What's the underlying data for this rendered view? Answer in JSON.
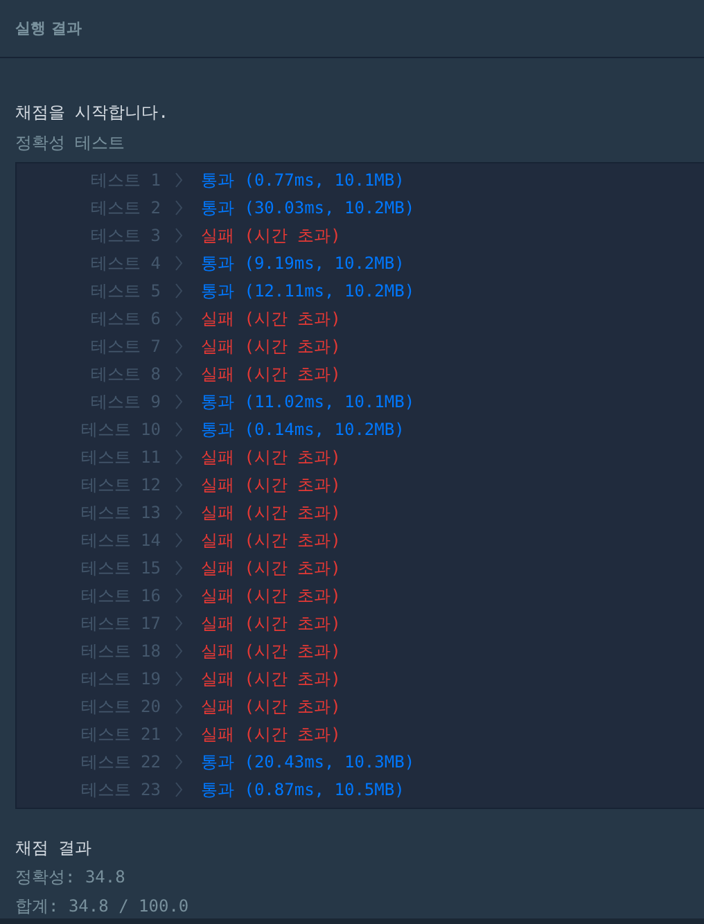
{
  "header": {
    "title": "실행 결과"
  },
  "intro": "채점을 시작합니다.",
  "section_title": "정확성  테스트",
  "tests": [
    {
      "label": "테스트 1",
      "kind": "pass",
      "status": "통과",
      "detail": "(0.77ms, 10.1MB)"
    },
    {
      "label": "테스트 2",
      "kind": "pass",
      "status": "통과",
      "detail": "(30.03ms, 10.2MB)"
    },
    {
      "label": "테스트 3",
      "kind": "fail",
      "status": "실패",
      "detail": "(시간 초과)"
    },
    {
      "label": "테스트 4",
      "kind": "pass",
      "status": "통과",
      "detail": "(9.19ms, 10.2MB)"
    },
    {
      "label": "테스트 5",
      "kind": "pass",
      "status": "통과",
      "detail": "(12.11ms, 10.2MB)"
    },
    {
      "label": "테스트 6",
      "kind": "fail",
      "status": "실패",
      "detail": "(시간 초과)"
    },
    {
      "label": "테스트 7",
      "kind": "fail",
      "status": "실패",
      "detail": "(시간 초과)"
    },
    {
      "label": "테스트 8",
      "kind": "fail",
      "status": "실패",
      "detail": "(시간 초과)"
    },
    {
      "label": "테스트 9",
      "kind": "pass",
      "status": "통과",
      "detail": "(11.02ms, 10.1MB)"
    },
    {
      "label": "테스트 10",
      "kind": "pass",
      "status": "통과",
      "detail": "(0.14ms, 10.2MB)"
    },
    {
      "label": "테스트 11",
      "kind": "fail",
      "status": "실패",
      "detail": "(시간 초과)"
    },
    {
      "label": "테스트 12",
      "kind": "fail",
      "status": "실패",
      "detail": "(시간 초과)"
    },
    {
      "label": "테스트 13",
      "kind": "fail",
      "status": "실패",
      "detail": "(시간 초과)"
    },
    {
      "label": "테스트 14",
      "kind": "fail",
      "status": "실패",
      "detail": "(시간 초과)"
    },
    {
      "label": "테스트 15",
      "kind": "fail",
      "status": "실패",
      "detail": "(시간 초과)"
    },
    {
      "label": "테스트 16",
      "kind": "fail",
      "status": "실패",
      "detail": "(시간 초과)"
    },
    {
      "label": "테스트 17",
      "kind": "fail",
      "status": "실패",
      "detail": "(시간 초과)"
    },
    {
      "label": "테스트 18",
      "kind": "fail",
      "status": "실패",
      "detail": "(시간 초과)"
    },
    {
      "label": "테스트 19",
      "kind": "fail",
      "status": "실패",
      "detail": "(시간 초과)"
    },
    {
      "label": "테스트 20",
      "kind": "fail",
      "status": "실패",
      "detail": "(시간 초과)"
    },
    {
      "label": "테스트 21",
      "kind": "fail",
      "status": "실패",
      "detail": "(시간 초과)"
    },
    {
      "label": "테스트 22",
      "kind": "pass",
      "status": "통과",
      "detail": "(20.43ms, 10.3MB)"
    },
    {
      "label": "테스트 23",
      "kind": "pass",
      "status": "통과",
      "detail": "(0.87ms, 10.5MB)"
    }
  ],
  "result": {
    "title": "채점 결과",
    "accuracy": "정확성: 34.8",
    "total": "합계: 34.8 / 100.0"
  }
}
